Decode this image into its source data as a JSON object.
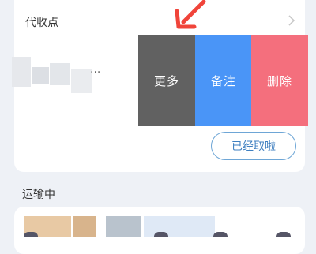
{
  "sections": {
    "pickup_point": "代收点",
    "in_transit": "运输中"
  },
  "item": {
    "ellipsis": "..."
  },
  "swipe_actions": {
    "more": "更多",
    "note": "备注",
    "delete": "删除"
  },
  "picked_button": "已经取啦",
  "colors": {
    "more_bg": "#616161",
    "note_bg": "#4a95f7",
    "delete_bg": "#f46f7d",
    "arrow": "#f0443a"
  }
}
